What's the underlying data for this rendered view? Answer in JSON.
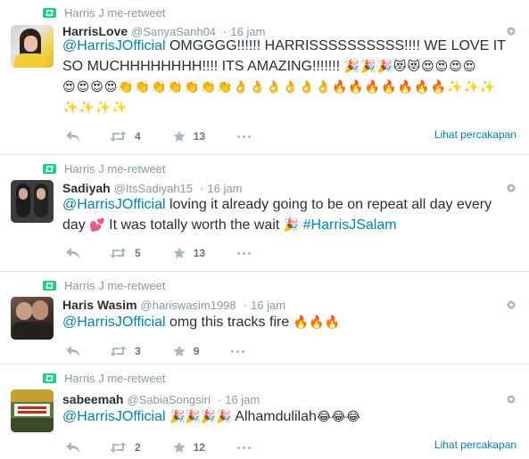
{
  "retweet_label": "Harris J me-retweet",
  "conversation_link": "Lihat percakapan",
  "colors": {
    "link": "#0084b4",
    "retweet_green": "#19cf86",
    "muted": "#8899a6"
  },
  "tweets": [
    {
      "name": "HarrisLove",
      "handle": "@SanyaSanh04",
      "time": "16 jam",
      "mention": "@HarrisJOfficial",
      "text_line1": " OMGGGG!!!!!! HARRISSSSSSSSSS!!!! WE LOVE IT",
      "text_line2": "SO MUCHHHHHHHH!!!!  ITS AMAZING!!!!!!! ",
      "emoji_line2": "🎉🎉🎉😻😻😍😍😍😍",
      "emoji_line3": "😍😍😍😍👏👏👏👏👏👏👏👌👌👌👌👌👌🔥🔥🔥🔥🔥🔥🔥✨✨✨",
      "emoji_line4": "✨✨✨✨",
      "retweets": "4",
      "favorites": "13",
      "show_conversation": true
    },
    {
      "name": "Sadiyah",
      "handle": "@ItsSadiyah15",
      "time": "16 jam",
      "mention": "@HarrisJOfficial",
      "text_line1": " loving it already going to be on repeat all day every",
      "text_line2": "day ",
      "emoji_a": "💕",
      "text_line2b": " It was totally worth the wait ",
      "emoji_b": "🎉",
      "hashtag": "#HarrisJSalam",
      "retweets": "5",
      "favorites": "13",
      "show_conversation": false
    },
    {
      "name": "Haris Wasim",
      "handle": "@hariswasim1998",
      "time": "16 jam",
      "mention": "@HarrisJOfficial",
      "text_line1": " omg this tracks fire ",
      "emoji": "🔥🔥🔥",
      "retweets": "3",
      "favorites": "9",
      "show_conversation": false
    },
    {
      "name": "sabeemah",
      "handle": "@SabiaSongsiri",
      "time": "16 jam",
      "mention": "@HarrisJOfficial",
      "emoji_a": "🎉🎉🎉🎉",
      "text_line1": " Alhamdulilah",
      "emoji_b": "😂😂😂",
      "retweets": "2",
      "favorites": "12",
      "show_conversation": true
    }
  ]
}
